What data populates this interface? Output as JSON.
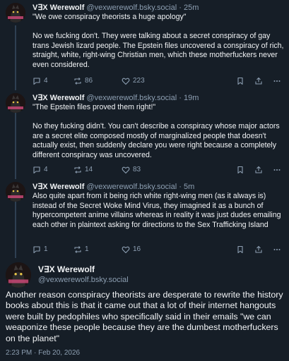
{
  "posts": [
    {
      "author": "V∃X Werewolf",
      "handle": "@vexwerewolf.bsky.social",
      "time": "25m",
      "text": "\"We owe conspiracy theorists a huge apology\"\n\nNo we fucking don't. They were talking about a secret conspiracy of gay trans Jewish lizard people. The Epstein files uncovered a conspiracy of rich, straight, white, right-wing Christian men, which these motherfuckers never even considered.",
      "replies": "4",
      "reposts": "86",
      "likes": "223"
    },
    {
      "author": "V∃X Werewolf",
      "handle": "@vexwerewolf.bsky.social",
      "time": "19m",
      "text": "\"The Epstein files proved them right!\"\n\nNo they fucking didn't. You can't describe a conspiracy whose major actors are a secret elite composed mostly of marginalized people that doesn't actually exist, then suddenly declare you were right because a completely different conspiracy was uncovered.",
      "replies": "4",
      "reposts": "14",
      "likes": "83"
    },
    {
      "author": "V∃X Werewolf",
      "handle": "@vexwerewolf.bsky.social",
      "time": "5m",
      "text": "Also quite apart from it being rich white right-wing men (as it always is) instead of the Secret Woke Mind Virus, they imagined it as a bunch of hypercompetent anime villains whereas in reality it was just dudes emailing each other in plaintext asking for directions to the Sex Trafficking Island",
      "replies": "1",
      "reposts": "1",
      "likes": "16"
    }
  ],
  "main_post": {
    "author": "V∃X Werewolf",
    "handle": "@vexwerewolf.bsky.social",
    "text": "Another reason conspiracy theorists are desperate to rewrite the history books about this is that it came out that a lot of their internet hangouts were built by pedophiles who specifically said in their emails \"we can weaponize these people because they are the dumbest motherfuckers on the planet\"",
    "timestamp": "2:23 PM · Feb 20, 2026"
  },
  "separator": "·",
  "colors": {
    "background": "#161e27",
    "muted": "#8d9fb2",
    "text": "#f1f3f5",
    "thread_line": "#2e4052"
  },
  "icons": [
    "avatar-icon",
    "reply-icon",
    "repost-icon",
    "like-icon",
    "bookmark-icon",
    "share-icon",
    "more-icon"
  ]
}
